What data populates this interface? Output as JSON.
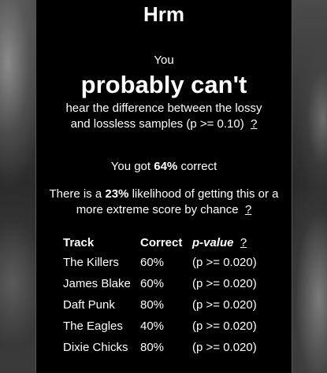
{
  "title": "Hrm",
  "verdict": {
    "lead": "You",
    "headline": "probably can't",
    "line1": "hear the difference between the lossy",
    "line2": "and lossless samples (p >= 0.10)",
    "help": "?"
  },
  "score": {
    "prefix": "You got",
    "percent": "64%",
    "suffix": "correct"
  },
  "likelihood": {
    "prefix": "There is a",
    "percent": "23%",
    "middle": "likelihood of getting this or a",
    "line2": "more extreme score by chance",
    "help": "?"
  },
  "table": {
    "headers": {
      "track": "Track",
      "correct": "Correct",
      "pvalue": "p-value",
      "help": "?"
    },
    "rows": [
      {
        "track": "The Killers",
        "correct": "60%",
        "pvalue": "(p >= 0.020)"
      },
      {
        "track": "James Blake",
        "correct": "60%",
        "pvalue": "(p >= 0.020)"
      },
      {
        "track": "Daft Punk",
        "correct": "80%",
        "pvalue": "(p >= 0.020)"
      },
      {
        "track": "The Eagles",
        "correct": "40%",
        "pvalue": "(p >= 0.020)"
      },
      {
        "track": "Dixie Chicks",
        "correct": "80%",
        "pvalue": "(p >= 0.020)"
      }
    ]
  }
}
